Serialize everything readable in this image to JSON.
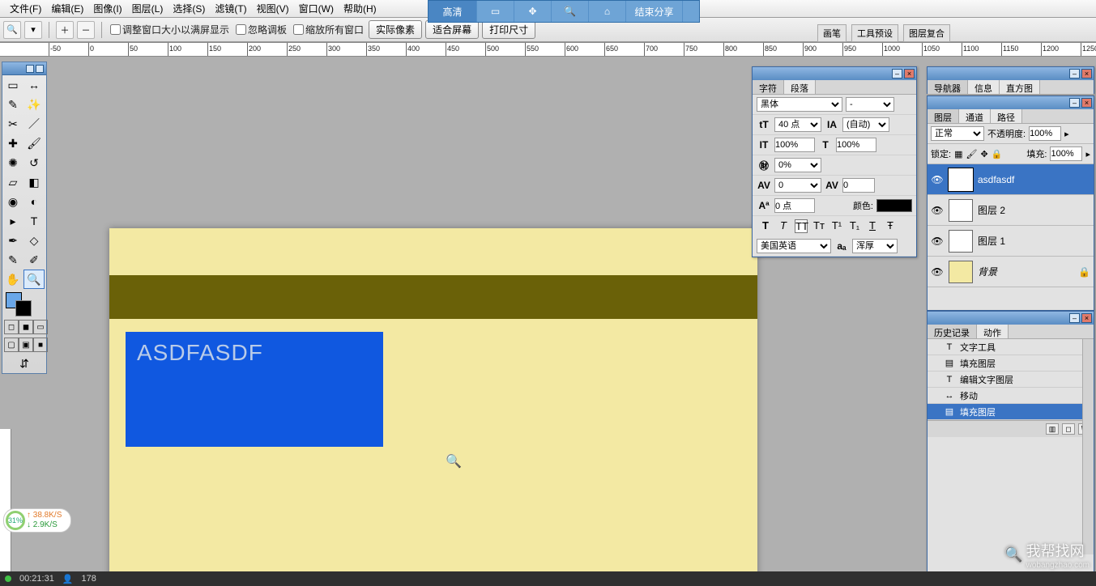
{
  "menu": [
    "文件(F)",
    "编辑(E)",
    "图像(I)",
    "图层(L)",
    "选择(S)",
    "滤镜(T)",
    "视图(V)",
    "窗口(W)",
    "帮助(H)"
  ],
  "options": {
    "cb1": "调整窗口大小以满屏显示",
    "cb2": "忽略调板",
    "cb3": "缩放所有窗口",
    "btn1": "实际像素",
    "btn2": "适合屏幕",
    "btn3": "打印尺寸"
  },
  "share": {
    "hd": "高清",
    "end": "结束分享"
  },
  "hints": [
    "画笔",
    "工具预设",
    "图层复合"
  ],
  "canvas_text": "ASDFASDF",
  "char": {
    "tab1": "字符",
    "tab2": "段落",
    "font": "黑体",
    "style": "-",
    "size": "40 点",
    "leading": "(自动)",
    "vscale": "100%",
    "hscale": "100%",
    "baseline": "0%",
    "tracking": "0",
    "kerning": "0",
    "shift": "0 点",
    "color_label": "颜色:",
    "lang": "美国英语",
    "aa": "浑厚"
  },
  "nav": {
    "tab1": "导航器",
    "tab2": "信息",
    "tab3": "直方图"
  },
  "layers": {
    "tab1": "图层",
    "tab2": "通道",
    "tab3": "路径",
    "blend": "正常",
    "opacity_label": "不透明度:",
    "opacity": "100%",
    "lock_label": "锁定:",
    "fill_label": "填充:",
    "fill": "100%",
    "items": [
      {
        "name": "asdfasdf",
        "type": "T"
      },
      {
        "name": "图层 2",
        "type": "checker"
      },
      {
        "name": "图层 1",
        "type": "checker"
      },
      {
        "name": "背景",
        "type": "bg",
        "locked": true
      }
    ]
  },
  "history": {
    "tab1": "历史记录",
    "tab2": "动作",
    "items": [
      {
        "ic": "T",
        "name": "文字工具"
      },
      {
        "ic": "▤",
        "name": "填充图层"
      },
      {
        "ic": "T",
        "name": "编辑文字图层"
      },
      {
        "ic": "↔",
        "name": "移动"
      },
      {
        "ic": "▤",
        "name": "填充图层",
        "active": true
      }
    ]
  },
  "speed": {
    "pct": "31%",
    "up": "38.8K/S",
    "dn": "2.9K/S"
  },
  "status": {
    "time": "00:21:31",
    "users": "178"
  },
  "watermark": {
    "big": "我帮找网",
    "small": "wobangzhao.com"
  }
}
